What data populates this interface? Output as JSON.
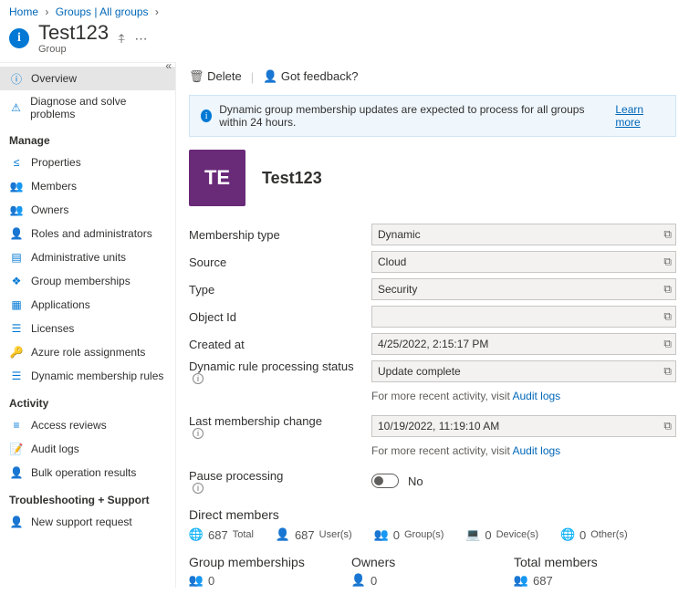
{
  "breadcrumb": {
    "home": "Home",
    "groups": "Groups | All groups"
  },
  "header": {
    "title": "Test123",
    "subtitle": "Group"
  },
  "sidebar": {
    "top": [
      {
        "label": "Overview",
        "icon": "info-icon",
        "color": "#0078d4",
        "selected": true
      },
      {
        "label": "Diagnose and solve problems",
        "icon": "wrench-icon",
        "color": "#0078d4"
      }
    ],
    "manage_heading": "Manage",
    "manage": [
      {
        "label": "Properties",
        "icon": "properties-icon",
        "color": "#0078d4"
      },
      {
        "label": "Members",
        "icon": "members-icon",
        "color": "#0078d4"
      },
      {
        "label": "Owners",
        "icon": "owners-icon",
        "color": "#0078d4"
      },
      {
        "label": "Roles and administrators",
        "icon": "roles-icon",
        "color": "#57a300"
      },
      {
        "label": "Administrative units",
        "icon": "admin-units-icon",
        "color": "#0078d4"
      },
      {
        "label": "Group memberships",
        "icon": "group-memberships-icon",
        "color": "#0078d4"
      },
      {
        "label": "Applications",
        "icon": "apps-icon",
        "color": "#0078d4"
      },
      {
        "label": "Licenses",
        "icon": "licenses-icon",
        "color": "#0078d4"
      },
      {
        "label": "Azure role assignments",
        "icon": "key-icon",
        "color": "#f2c811"
      },
      {
        "label": "Dynamic membership rules",
        "icon": "rules-icon",
        "color": "#0078d4"
      }
    ],
    "activity_heading": "Activity",
    "activity": [
      {
        "label": "Access reviews",
        "icon": "access-icon",
        "color": "#0078d4"
      },
      {
        "label": "Audit logs",
        "icon": "audit-icon",
        "color": "#0078d4"
      },
      {
        "label": "Bulk operation results",
        "icon": "bulk-icon",
        "color": "#57a300"
      }
    ],
    "trouble_heading": "Troubleshooting + Support",
    "trouble": [
      {
        "label": "New support request",
        "icon": "support-icon",
        "color": "#0078d4"
      }
    ]
  },
  "toolbar": {
    "delete": "Delete",
    "feedback": "Got feedback?"
  },
  "alert": {
    "text": "Dynamic group membership updates are expected to process for all groups within 24 hours.",
    "link": "Learn more"
  },
  "hero": {
    "initials": "TE",
    "name": "Test123"
  },
  "props": {
    "membership_type": {
      "label": "Membership type",
      "value": "Dynamic"
    },
    "source": {
      "label": "Source",
      "value": "Cloud"
    },
    "type": {
      "label": "Type",
      "value": "Security"
    },
    "object_id": {
      "label": "Object Id",
      "value": ""
    },
    "created_at": {
      "label": "Created at",
      "value": "4/25/2022, 2:15:17 PM"
    },
    "rule_status": {
      "label": "Dynamic rule processing status",
      "value": "Update complete",
      "hint_pre": "For more recent activity, visit ",
      "hint_link": "Audit logs"
    },
    "last_change": {
      "label": "Last membership change",
      "value": "10/19/2022, 11:19:10 AM",
      "hint_pre": "For more recent activity, visit ",
      "hint_link": "Audit logs"
    },
    "pause": {
      "label": "Pause processing",
      "value": "No"
    }
  },
  "direct": {
    "heading": "Direct members",
    "total": {
      "n": "687",
      "label": "Total"
    },
    "users": {
      "n": "687",
      "label": "User(s)"
    },
    "groups": {
      "n": "0",
      "label": "Group(s)"
    },
    "devices": {
      "n": "0",
      "label": "Device(s)"
    },
    "others": {
      "n": "0",
      "label": "Other(s)"
    }
  },
  "bottom": {
    "memberships": {
      "heading": "Group memberships",
      "value": "0"
    },
    "owners": {
      "heading": "Owners",
      "value": "0"
    },
    "totalmembers": {
      "heading": "Total members",
      "value": "687"
    }
  }
}
